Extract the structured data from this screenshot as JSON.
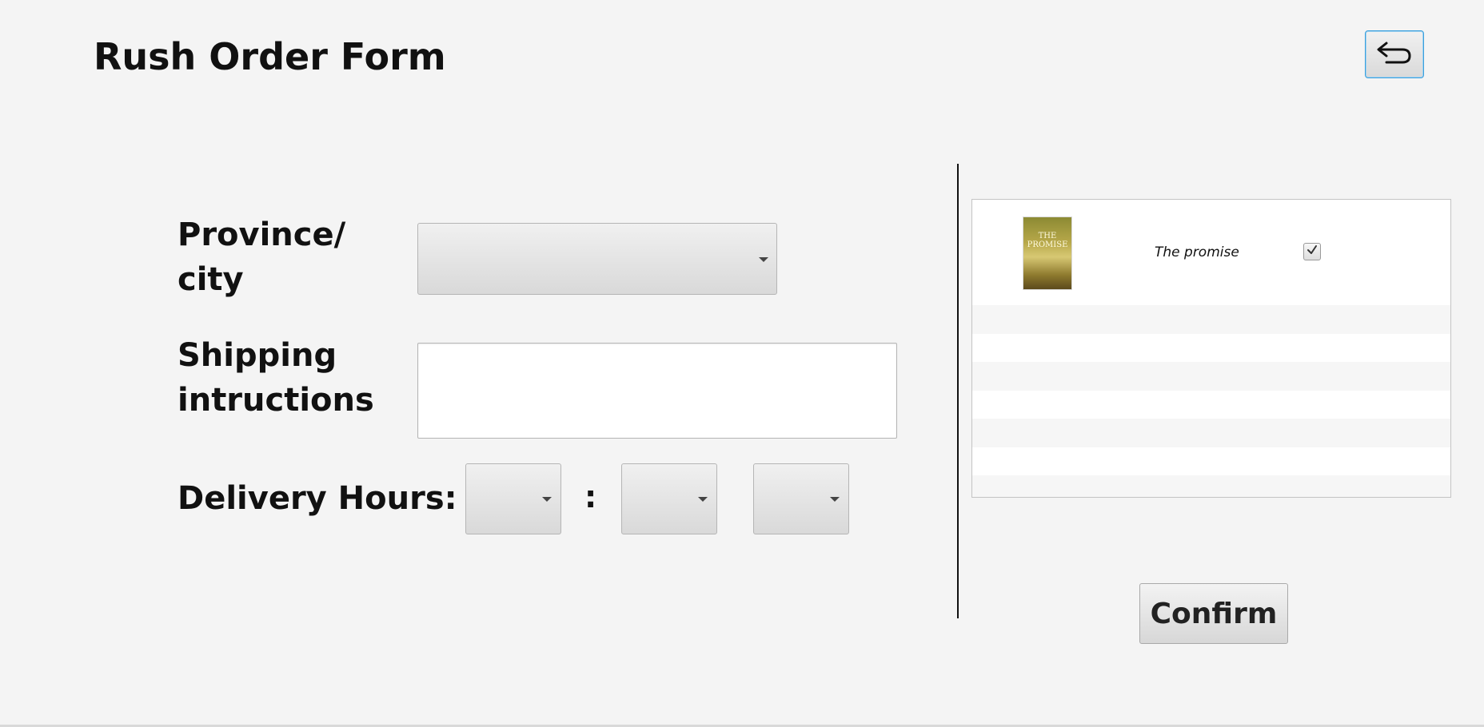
{
  "header": {
    "title": "Rush Order Form",
    "back_icon": "back-arrow-icon"
  },
  "form": {
    "province_label": "Province/ city",
    "province_value": "",
    "shipping_label": "Shipping intructions",
    "shipping_value": "",
    "delivery_label": "Delivery Hours:",
    "separator": ":",
    "hour_value": "",
    "minute_value": "",
    "period_value": ""
  },
  "order_list": {
    "items": [
      {
        "cover_title": "THE PROMISE",
        "title": "The promise",
        "checked": true
      }
    ]
  },
  "actions": {
    "confirm_label": "Confirm"
  }
}
